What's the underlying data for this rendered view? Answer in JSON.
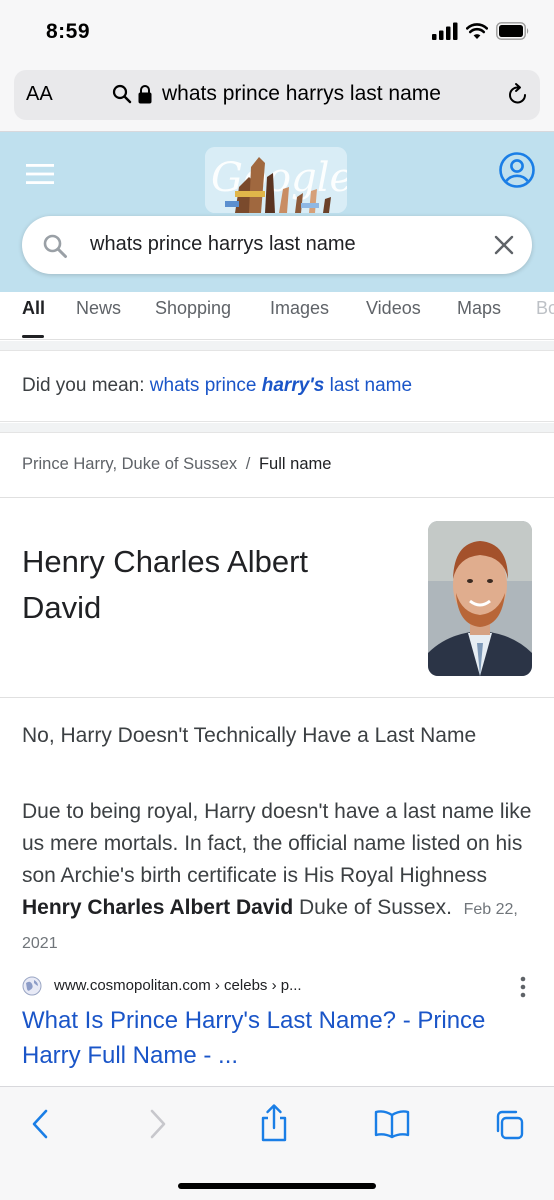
{
  "status_bar": {
    "time": "8:59"
  },
  "address_bar": {
    "text_size_label": "AA",
    "url": "whats prince harrys last name"
  },
  "google": {
    "search_query": "whats prince harrys last name",
    "tabs": [
      {
        "label": "All"
      },
      {
        "label": "News"
      },
      {
        "label": "Shopping"
      },
      {
        "label": "Images"
      },
      {
        "label": "Videos"
      },
      {
        "label": "Maps"
      },
      {
        "label": "Bo"
      }
    ]
  },
  "did_you_mean": {
    "prefix": "Did you mean:",
    "pre": "whats prince ",
    "bold": "harry's",
    "post": " last name"
  },
  "knowledge": {
    "breadcrumb_entity": "Prince Harry, Duke of Sussex",
    "breadcrumb_sep": "/",
    "breadcrumb_current": "Full name",
    "answer": "Henry Charles Albert David"
  },
  "snippet": {
    "title": "No, Harry Doesn't Technically Have a Last Name",
    "body_part1": "Due to being royal, Harry doesn't have a last name like us mere mortals. In fact, the official name listed on his son Archie's birth certificate is His Royal Highness ",
    "body_bold": "Henry Charles Albert David",
    "body_part2": " Duke of Sussex.",
    "date": "Feb 22, 2021",
    "source_url": "www.cosmopolitan.com › celebs › p...",
    "result_title": "What Is Prince Harry's Last Name? - Prince Harry Full Name - ..."
  },
  "colors": {
    "link": "#1a55c8",
    "header_bg": "#bfe0ee",
    "ios_blue": "#1a7ee6"
  }
}
